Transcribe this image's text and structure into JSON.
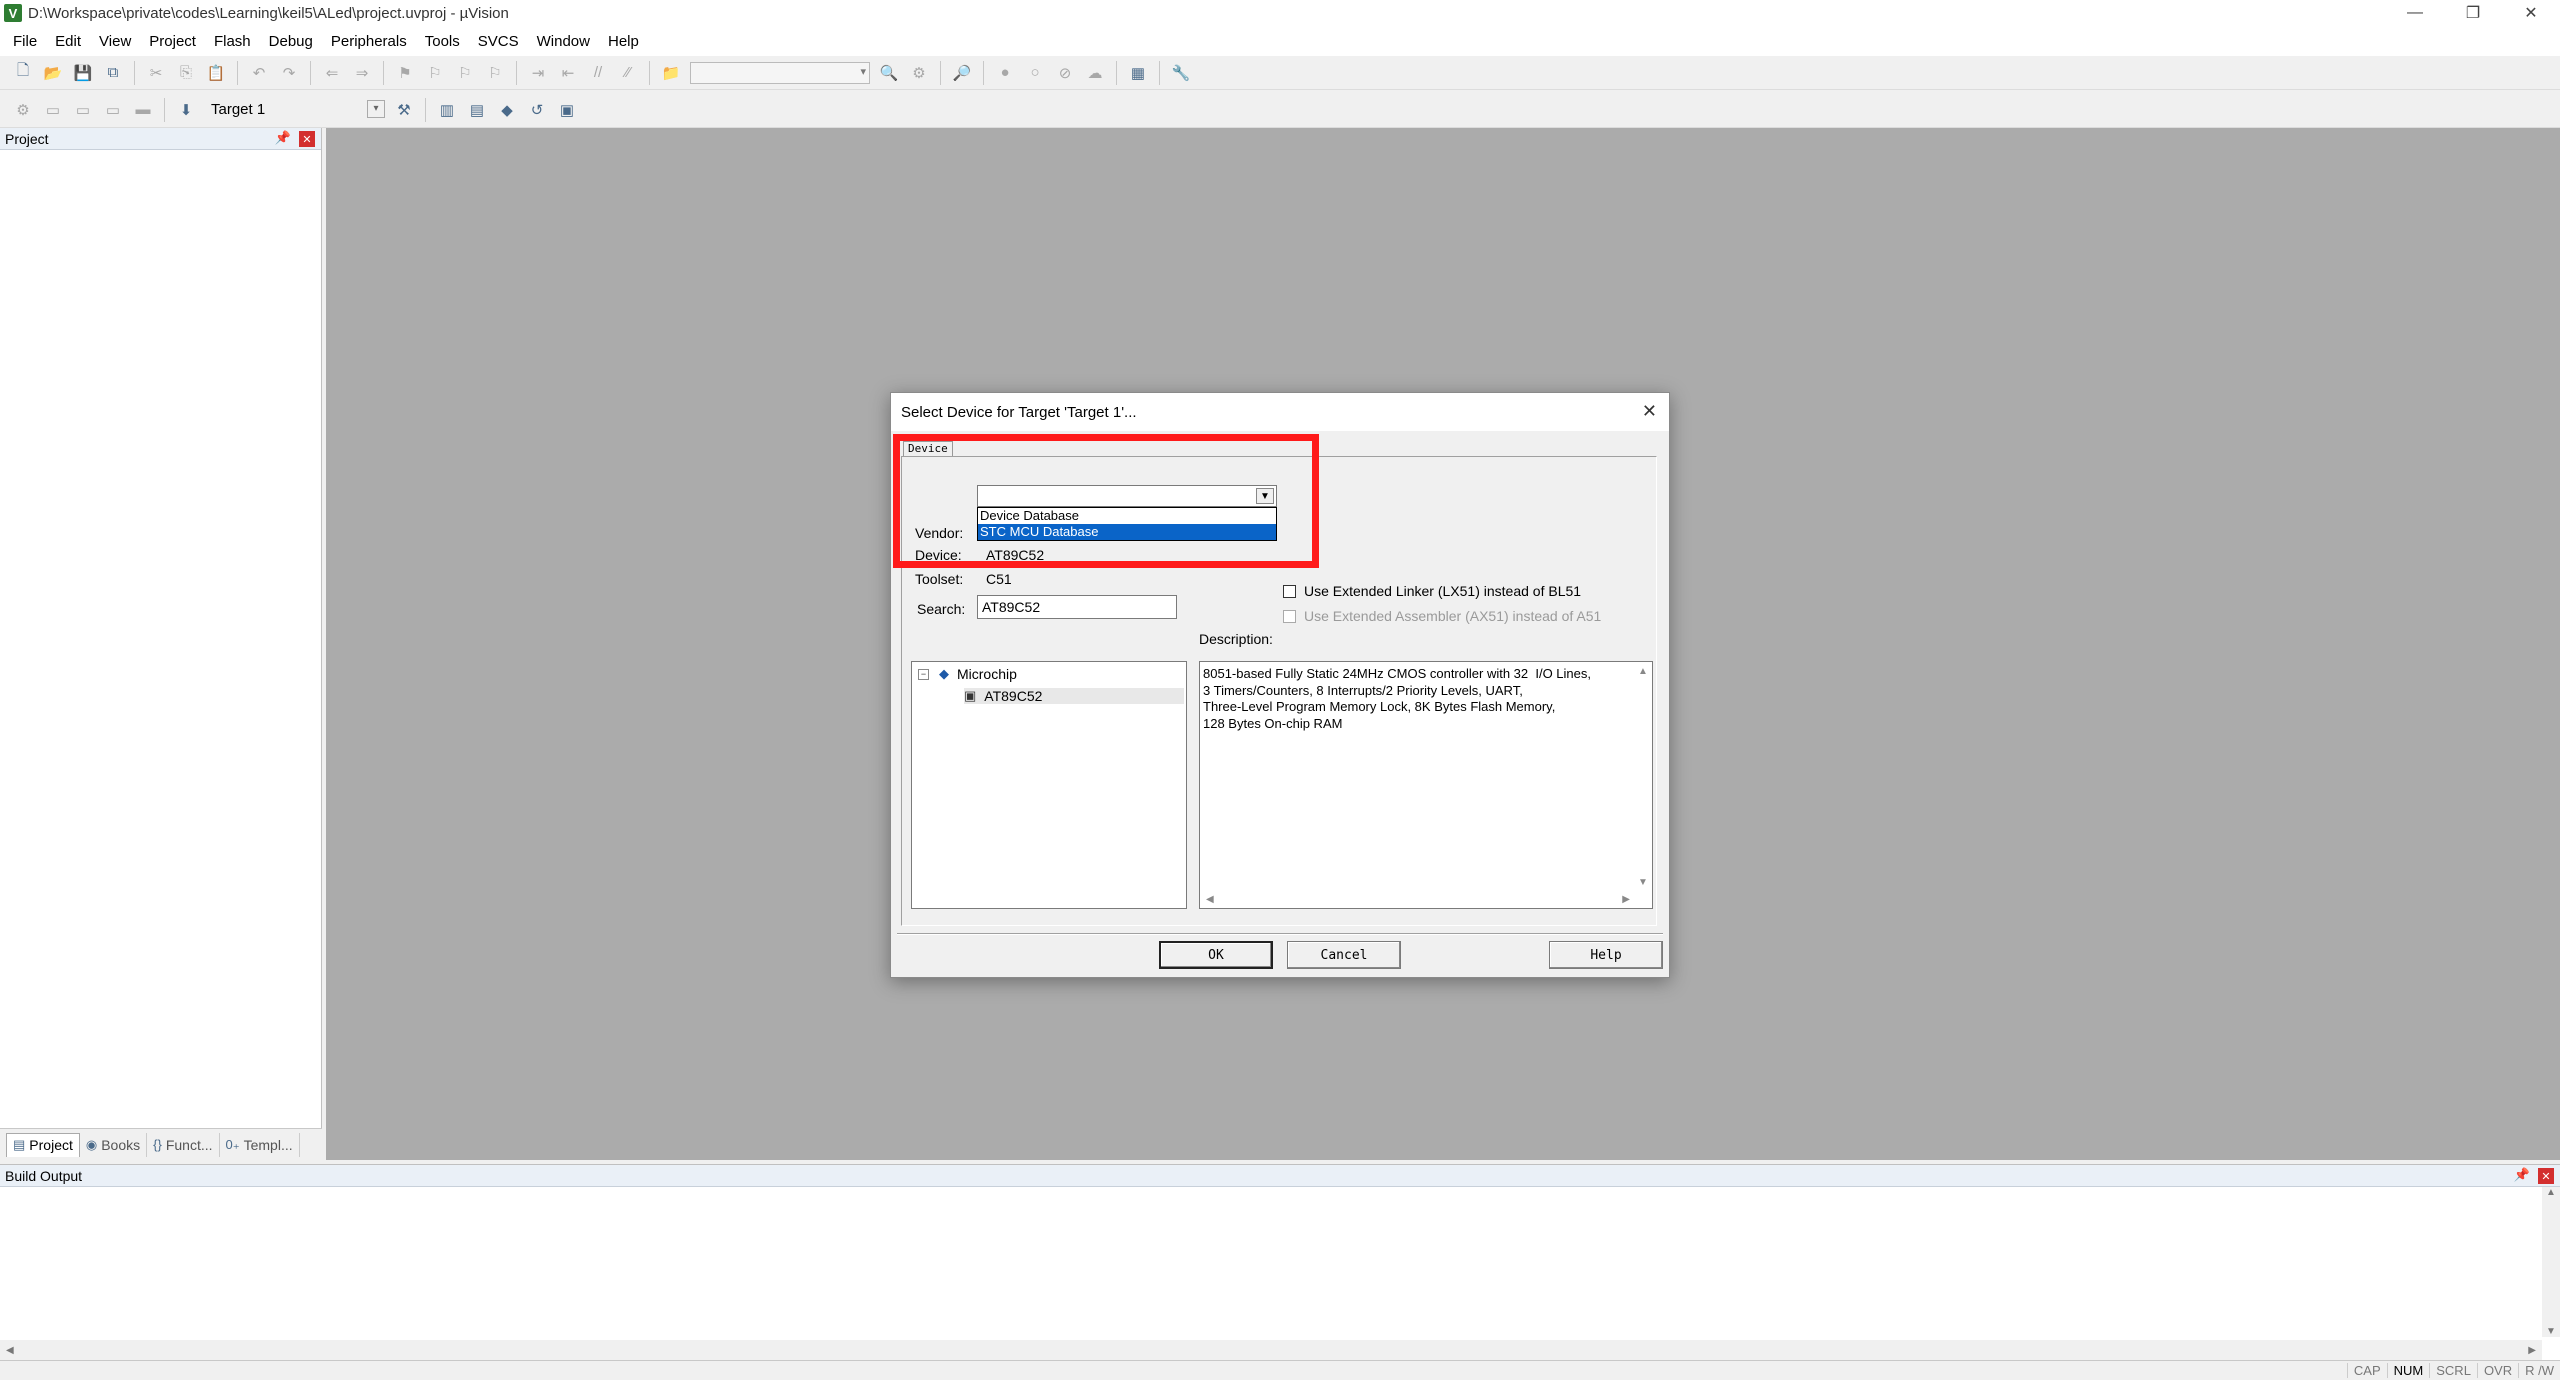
{
  "window": {
    "title": "D:\\Workspace\\private\\codes\\Learning\\keil5\\ALed\\project.uvproj - µVision",
    "controls": [
      "—",
      "❐",
      "✕"
    ]
  },
  "menu": [
    "File",
    "Edit",
    "View",
    "Project",
    "Flash",
    "Debug",
    "Peripherals",
    "Tools",
    "SVCS",
    "Window",
    "Help"
  ],
  "toolbar2": {
    "target": "Target 1"
  },
  "project_pane": {
    "title": "Project",
    "tabs": [
      "Project",
      "Books",
      "Funct...",
      "Templ..."
    ],
    "tab_icons": [
      "▤",
      "◉",
      "{}",
      "0₊"
    ]
  },
  "build_output": {
    "title": "Build Output"
  },
  "status": [
    "CAP",
    "NUM",
    "SCRL",
    "OVR",
    "R /W"
  ],
  "dialog": {
    "title": "Select Device for Target 'Target 1'...",
    "tab": "Device",
    "vendor_label": "Vendor:",
    "vendor_value": "",
    "vendor_options": [
      "Device Database",
      "STC MCU Database"
    ],
    "vendor_selected": "STC MCU Database",
    "device_label": "Device:",
    "device_value": "AT89C52",
    "toolset_label": "Toolset:",
    "toolset_value": "C51",
    "search_label": "Search:",
    "search_value": "AT89C52",
    "chk_linker": "Use Extended Linker (LX51) instead of BL51",
    "chk_assembler": "Use Extended Assembler (AX51) instead of A51",
    "description_label": "Description:",
    "tree_vendor": "Microchip",
    "tree_device": "AT89C52",
    "description": "8051-based Fully Static 24MHz CMOS controller with 32  I/O Lines,\n3 Timers/Counters, 8 Interrupts/2 Priority Levels, UART,\nThree-Level Program Memory Lock, 8K Bytes Flash Memory,\n128 Bytes On-chip RAM",
    "ok": "OK",
    "cancel": "Cancel",
    "help": "Help",
    "close": "✕"
  },
  "colors": {
    "highlight": "#ff1a1a",
    "selection": "#0a64c8",
    "workspace": "#ababab"
  }
}
